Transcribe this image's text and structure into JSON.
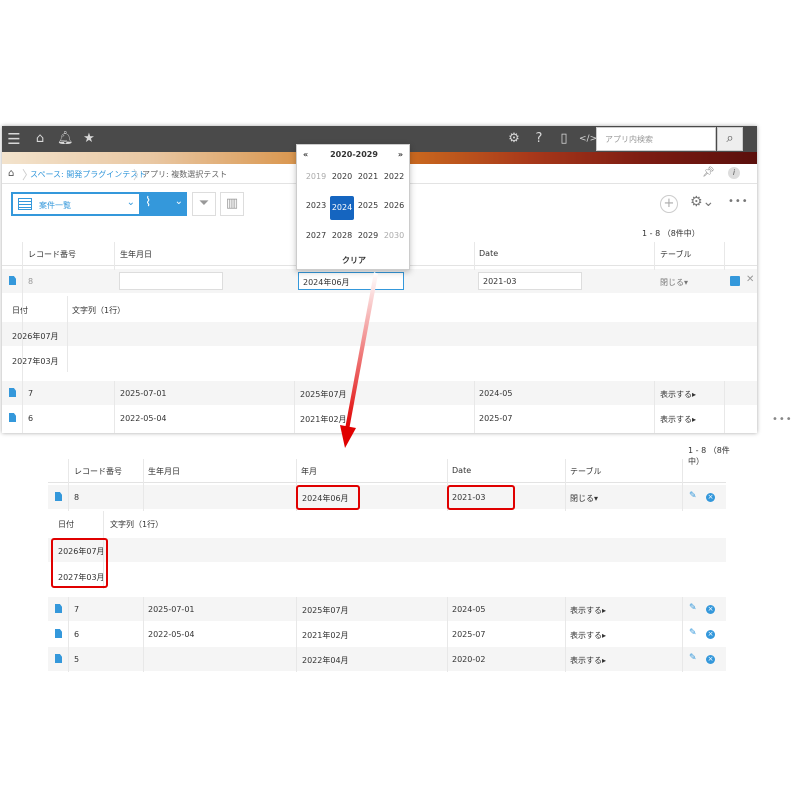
{
  "top": {
    "search_placeholder": "アプリ内検索"
  },
  "breadcrumb": {
    "space": "スペース: 開発プラグインテスト",
    "app": "アプリ: 複数選択テスト"
  },
  "toolbar": {
    "view_label": "案件一覧"
  },
  "pager": "1 - 8 （8件中）",
  "columns": {
    "record_no": "レコード番号",
    "birthday": "生年月日",
    "year_month": "年月",
    "date": "Date",
    "table": "テーブル"
  },
  "subtable_columns": {
    "date": "日付",
    "text": "文字列（1行）"
  },
  "picker": {
    "prev": "«",
    "next": "»",
    "range": "2020-2029",
    "years": [
      "2019",
      "2020",
      "2021",
      "2022",
      "2023",
      "2024",
      "2025",
      "2026",
      "2027",
      "2028",
      "2029",
      "2030"
    ],
    "selected": "2024",
    "clear": "クリア"
  },
  "edit_row": {
    "record_no": "8",
    "year_month": "2024年06月",
    "date": "2021-03",
    "table_toggle": "閉じる▾"
  },
  "subtable_rows": [
    "2026年07月",
    "2027年03月"
  ],
  "rows": [
    {
      "record_no": "7",
      "birthday": "2025-07-01",
      "year_month": "2025年07月",
      "date": "2024-05",
      "table_toggle": "表示する▸"
    },
    {
      "record_no": "6",
      "birthday": "2022-05-04",
      "year_month": "2021年02月",
      "date": "2025-07",
      "table_toggle": "表示する▸"
    },
    {
      "record_no": "5",
      "birthday": "",
      "year_month": "2022年04月",
      "date": "2020-02",
      "table_toggle": "表示する▸"
    }
  ],
  "colors": {
    "accent": "#3498db",
    "highlight": "#e00000",
    "selected_year": "#1565c0",
    "topbar": "#4a4a4a"
  }
}
